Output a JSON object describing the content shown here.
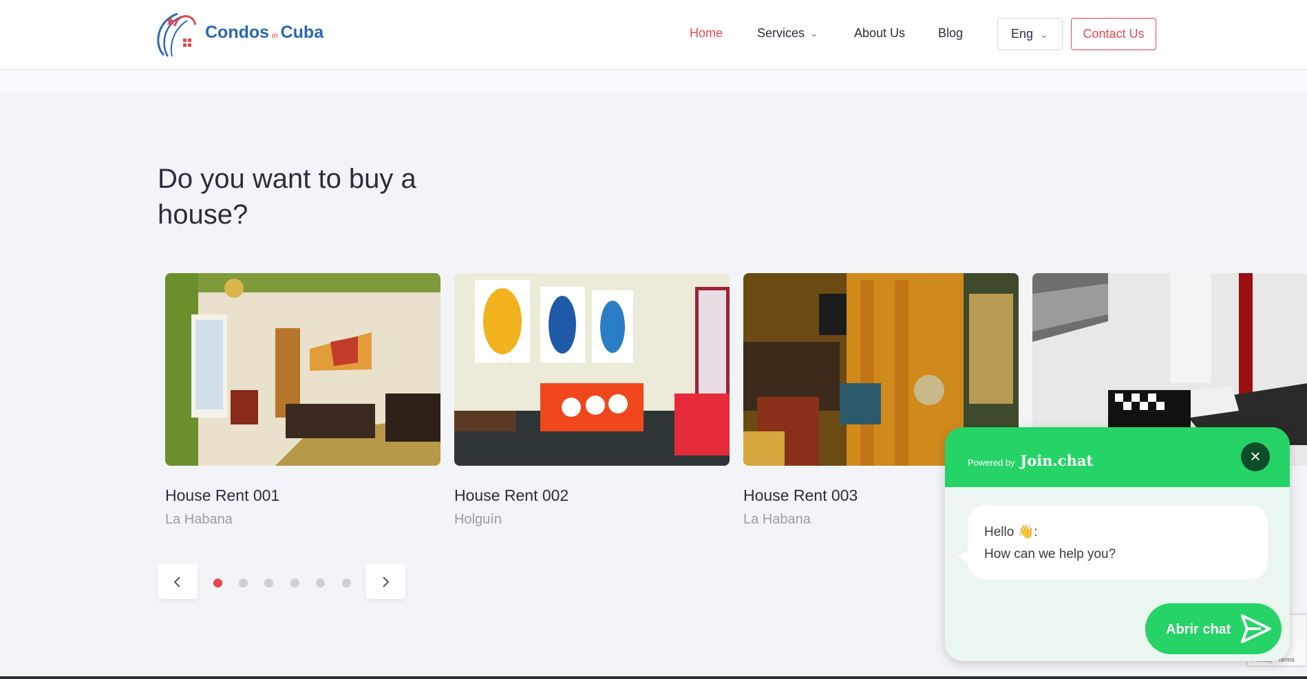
{
  "header": {
    "logo": {
      "text_main": "Condos",
      "text_small": "in",
      "text_end": "Cuba"
    },
    "nav": [
      {
        "label": "Home",
        "active": true
      },
      {
        "label": "Services",
        "has_dropdown": true
      },
      {
        "label": "About Us"
      },
      {
        "label": "Blog"
      }
    ],
    "language": "Eng",
    "contact_label": "Contact Us"
  },
  "section": {
    "title": "Do you want to buy a house?",
    "cards": [
      {
        "name": "House Rent 001",
        "location": "La Habana"
      },
      {
        "name": "House Rent 002",
        "location": "Holguín"
      },
      {
        "name": "House Rent 003",
        "location": "La Habana"
      },
      {
        "name": "",
        "location": ""
      }
    ],
    "carousel": {
      "total_dots": 6,
      "active_dot": 1
    }
  },
  "chat": {
    "powered_prefix": "Powered by",
    "powered_brand": "Join.chat",
    "greeting_line1": "Hello 👋:",
    "greeting_line2": "How can we help you?",
    "button_label": "Abrir chat"
  },
  "recaptcha": {
    "text": "Privacy - Terms"
  },
  "colors": {
    "accent": "#e8464e",
    "brand_blue": "#2a66b6",
    "chat_green": "#25d366",
    "background": "#f3f4f8"
  }
}
